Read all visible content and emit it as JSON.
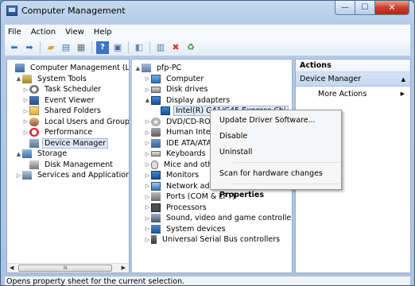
{
  "window": {
    "title": "Computer Management"
  },
  "menu": [
    "File",
    "Action",
    "View",
    "Help"
  ],
  "toolbar_icons": [
    "back-arrow-icon",
    "forward-arrow-icon",
    "up-folder-icon",
    "show-hide-tree-icon",
    "properties-icon",
    "help-icon",
    "console-icon",
    "export-list-icon",
    "scan-hardware-icon",
    "uninstall-icon",
    "update-driver-icon"
  ],
  "left_tree": [
    {
      "label": "Computer Management (Local",
      "indent": 0,
      "arrow": "",
      "icon": "root"
    },
    {
      "label": "System Tools",
      "indent": 1,
      "arrow": "▲",
      "icon": "tools"
    },
    {
      "label": "Task Scheduler",
      "indent": 2,
      "arrow": "▷",
      "icon": "clock"
    },
    {
      "label": "Event Viewer",
      "indent": 2,
      "arrow": "▷",
      "icon": "event"
    },
    {
      "label": "Shared Folders",
      "indent": 2,
      "arrow": "▷",
      "icon": "folder"
    },
    {
      "label": "Local Users and Groups",
      "indent": 2,
      "arrow": "▷",
      "icon": "users"
    },
    {
      "label": "Performance",
      "indent": 2,
      "arrow": "▷",
      "icon": "perf"
    },
    {
      "label": "Device Manager",
      "indent": 2,
      "arrow": "",
      "icon": "devmgr",
      "selected": true
    },
    {
      "label": "Storage",
      "indent": 1,
      "arrow": "▲",
      "icon": "storage"
    },
    {
      "label": "Disk Management",
      "indent": 2,
      "arrow": "",
      "icon": "diskmgmt"
    },
    {
      "label": "Services and Applications",
      "indent": 1,
      "arrow": "▷",
      "icon": "services"
    }
  ],
  "device_tree": [
    {
      "label": "pfp-PC",
      "indent": 0,
      "arrow": "▲",
      "icon": "pc"
    },
    {
      "label": "Computer",
      "indent": 1,
      "arrow": "▷",
      "icon": "computer"
    },
    {
      "label": "Disk drives",
      "indent": 1,
      "arrow": "▷",
      "icon": "disk"
    },
    {
      "label": "Display adapters",
      "indent": 1,
      "arrow": "▲",
      "icon": "display"
    },
    {
      "label": "Intel(R) G41/G45 Express Chi",
      "indent": 2,
      "arrow": "",
      "icon": "display",
      "selected": true
    },
    {
      "label": "DVD/CD-ROM drives",
      "indent": 1,
      "arrow": "▷",
      "icon": "dvd"
    },
    {
      "label": "Human Interface Devices",
      "indent": 1,
      "arrow": "▷",
      "icon": "hid"
    },
    {
      "label": "IDE ATA/ATAPI controllers",
      "indent": 1,
      "arrow": "▷",
      "icon": "ide"
    },
    {
      "label": "Keyboards",
      "indent": 1,
      "arrow": "▷",
      "icon": "kbd"
    },
    {
      "label": "Mice and other pointing devices",
      "indent": 1,
      "arrow": "▷",
      "icon": "mouse"
    },
    {
      "label": "Monitors",
      "indent": 1,
      "arrow": "▷",
      "icon": "monitor"
    },
    {
      "label": "Network adapters",
      "indent": 1,
      "arrow": "▷",
      "icon": "net"
    },
    {
      "label": "Ports (COM & LPT)",
      "indent": 1,
      "arrow": "▷",
      "icon": "port"
    },
    {
      "label": "Processors",
      "indent": 1,
      "arrow": "▷",
      "icon": "proc"
    },
    {
      "label": "Sound, video and game controllers",
      "indent": 1,
      "arrow": "▷",
      "icon": "sound"
    },
    {
      "label": "System devices",
      "indent": 1,
      "arrow": "▷",
      "icon": "sys"
    },
    {
      "label": "Universal Serial Bus controllers",
      "indent": 1,
      "arrow": "▷",
      "icon": "usb"
    }
  ],
  "actions": {
    "header": "Actions",
    "section": "Device Manager",
    "item": "More Actions"
  },
  "context_menu": {
    "items": [
      "Update Driver Software...",
      "Disable",
      "Uninstall",
      "Scan for hardware changes",
      "Properties"
    ]
  },
  "status": "Opens property sheet for the current selection.",
  "hscroll_thumb_label": "III"
}
